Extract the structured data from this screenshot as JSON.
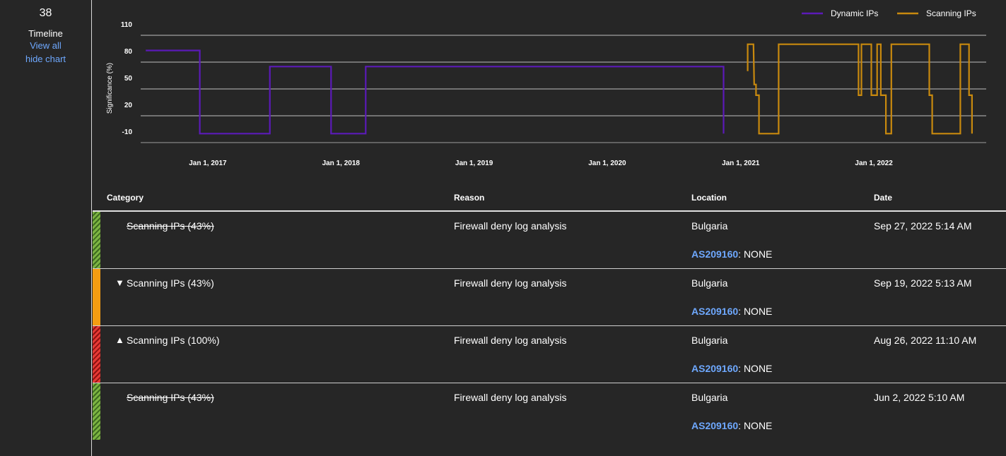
{
  "sidebar": {
    "count": "38",
    "timeline_label": "Timeline",
    "view_all": "View all",
    "hide_chart": "hide chart"
  },
  "chart_data": {
    "type": "line",
    "ylabel": "Significance (%)",
    "ylim": [
      -10,
      110
    ],
    "yticks": [
      "110",
      "80",
      "50",
      "20",
      "-10"
    ],
    "xticks": [
      "Jan 1, 2017",
      "Jan 1, 2018",
      "Jan 1, 2019",
      "Jan 1, 2020",
      "Jan 1, 2021",
      "Jan 1, 2022"
    ],
    "xlim": [
      "2016-07-01",
      "2022-11-05"
    ],
    "legend_position": "top-right",
    "series": [
      {
        "name": "Dynamic IPs",
        "color": "#5b1ab8",
        "points": [
          [
            "2016-07-15",
            93
          ],
          [
            "2016-12-10",
            93
          ],
          [
            "2016-12-10",
            0
          ],
          [
            "2017-06-20",
            0
          ],
          [
            "2017-06-20",
            75
          ],
          [
            "2017-12-05",
            75
          ],
          [
            "2017-12-05",
            0
          ],
          [
            "2018-03-10",
            0
          ],
          [
            "2018-03-10",
            75
          ],
          [
            "2020-11-15",
            75
          ],
          [
            "2020-11-15",
            0
          ]
        ]
      },
      {
        "name": "Scanning IPs",
        "color": "#c8890e",
        "points": [
          [
            "2021-01-20",
            70
          ],
          [
            "2021-01-20",
            100
          ],
          [
            "2021-02-05",
            100
          ],
          [
            "2021-02-05",
            100
          ],
          [
            "2021-02-07",
            55
          ],
          [
            "2021-02-12",
            55
          ],
          [
            "2021-02-12",
            43
          ],
          [
            "2021-02-20",
            43
          ],
          [
            "2021-02-20",
            0
          ],
          [
            "2021-04-15",
            0
          ],
          [
            "2021-04-15",
            100
          ],
          [
            "2021-11-20",
            100
          ],
          [
            "2021-11-20",
            43
          ],
          [
            "2021-11-28",
            43
          ],
          [
            "2021-11-28",
            100
          ],
          [
            "2021-12-25",
            100
          ],
          [
            "2021-12-25",
            43
          ],
          [
            "2022-01-10",
            43
          ],
          [
            "2022-01-10",
            100
          ],
          [
            "2022-01-20",
            100
          ],
          [
            "2022-01-20",
            43
          ],
          [
            "2022-02-03",
            43
          ],
          [
            "2022-02-03",
            0
          ],
          [
            "2022-02-18",
            0
          ],
          [
            "2022-02-18",
            100
          ],
          [
            "2022-06-02",
            100
          ],
          [
            "2022-06-02",
            43
          ],
          [
            "2022-06-10",
            43
          ],
          [
            "2022-06-10",
            0
          ],
          [
            "2022-08-26",
            0
          ],
          [
            "2022-08-26",
            100
          ],
          [
            "2022-09-19",
            100
          ],
          [
            "2022-09-19",
            43
          ],
          [
            "2022-09-27",
            43
          ],
          [
            "2022-09-27",
            0
          ]
        ]
      }
    ]
  },
  "table": {
    "headers": {
      "category": "Category",
      "reason": "Reason",
      "location": "Location",
      "date": "Date"
    },
    "rows": [
      {
        "status_color": "green",
        "arrow": "",
        "category": "Scanning IPs (43%)",
        "struck": true,
        "reason": "Firewall deny log analysis",
        "location": "Bulgaria",
        "asn": "AS209160",
        "asn_suffix": ": NONE",
        "date": "Sep 27, 2022 5:14 AM"
      },
      {
        "status_color": "orange",
        "arrow": "▼",
        "category": "Scanning IPs (43%)",
        "struck": false,
        "reason": "Firewall deny log analysis",
        "location": "Bulgaria",
        "asn": "AS209160",
        "asn_suffix": ": NONE",
        "date": "Sep 19, 2022 5:13 AM"
      },
      {
        "status_color": "red",
        "arrow": "▲",
        "category": "Scanning IPs (100%)",
        "struck": false,
        "reason": "Firewall deny log analysis",
        "location": "Bulgaria",
        "asn": "AS209160",
        "asn_suffix": ": NONE",
        "date": "Aug 26, 2022 11:10 AM"
      },
      {
        "status_color": "green",
        "arrow": "",
        "category": "Scanning IPs (43%)",
        "struck": true,
        "reason": "Firewall deny log analysis",
        "location": "Bulgaria",
        "asn": "AS209160",
        "asn_suffix": ": NONE",
        "date": "Jun 2, 2022 5:10 AM"
      }
    ]
  }
}
